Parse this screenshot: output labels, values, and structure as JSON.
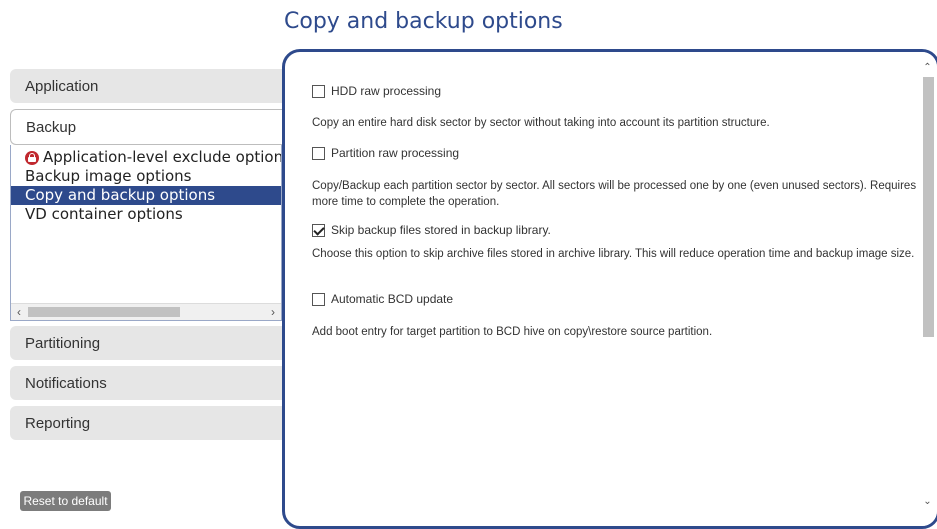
{
  "page": {
    "title": "Copy and backup options"
  },
  "sidebar": {
    "groups": [
      {
        "label": "Application"
      },
      {
        "label": "Backup"
      },
      {
        "label": "Partitioning"
      },
      {
        "label": "Notifications"
      },
      {
        "label": "Reporting"
      }
    ],
    "backup_items": [
      {
        "label": "Application-level exclude options",
        "icon": "lock-icon"
      },
      {
        "label": "Backup image options"
      },
      {
        "label": "Copy and backup options",
        "selected": true
      },
      {
        "label": "VD container options"
      }
    ],
    "reset_label": "Reset to default"
  },
  "options": [
    {
      "label": "HDD raw processing",
      "checked": false,
      "description": "Copy an entire hard disk sector by sector without taking into account its partition structure."
    },
    {
      "label": "Partition raw processing",
      "checked": false,
      "description": "Copy/Backup each partition sector by sector. All sectors will be processed one by one (even unused sectors). Requires more time to complete the operation."
    },
    {
      "label": "Skip backup files stored in backup library.",
      "checked": true,
      "description": "Choose this option to skip archive files stored in archive library. This will reduce operation time and backup image size."
    },
    {
      "label": "Automatic BCD update",
      "checked": false,
      "description": "Add boot entry for target partition to BCD hive on copy\\restore source partition."
    }
  ],
  "colors": {
    "accent": "#2e4a8c",
    "nav_bg": "#e6e6e6",
    "lock": "#c0282e"
  }
}
